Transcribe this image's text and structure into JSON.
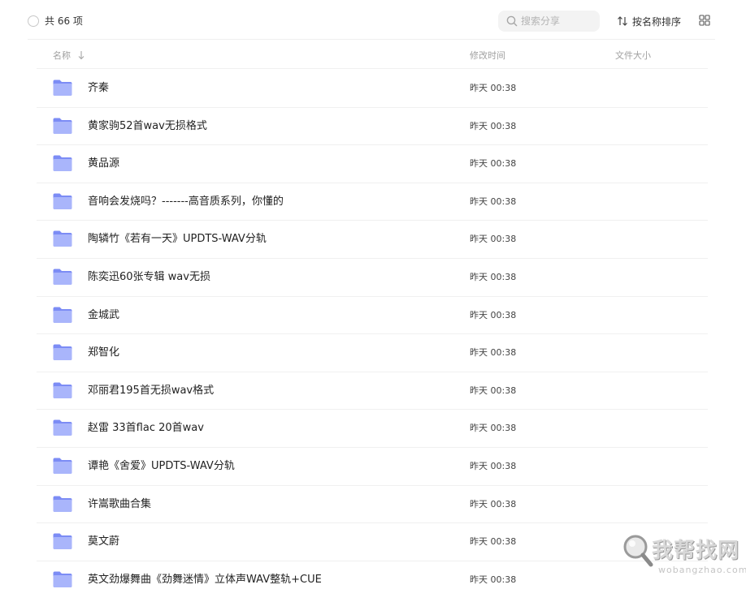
{
  "toolbar": {
    "count_label": "共 66 项",
    "search_placeholder": "搜索分享",
    "sort_label": "按名称排序"
  },
  "header": {
    "name": "名称",
    "modified": "修改时间",
    "size": "文件大小"
  },
  "files": [
    {
      "name": "齐秦",
      "modified": "昨天 00:38",
      "size": ""
    },
    {
      "name": "黄家驹52首wav无损格式",
      "modified": "昨天 00:38",
      "size": ""
    },
    {
      "name": "黄品源",
      "modified": "昨天 00:38",
      "size": ""
    },
    {
      "name": "音响会发烧吗？-------高音质系列，你懂的",
      "modified": "昨天 00:38",
      "size": ""
    },
    {
      "name": "陶辚竹《若有一天》UPDTS-WAV分轨",
      "modified": "昨天 00:38",
      "size": ""
    },
    {
      "name": "陈奕迅60张专辑 wav无损",
      "modified": "昨天 00:38",
      "size": ""
    },
    {
      "name": "金城武",
      "modified": "昨天 00:38",
      "size": ""
    },
    {
      "name": "郑智化",
      "modified": "昨天 00:38",
      "size": ""
    },
    {
      "name": "邓丽君195首无损wav格式",
      "modified": "昨天 00:38",
      "size": ""
    },
    {
      "name": "赵雷 33首flac 20首wav",
      "modified": "昨天 00:38",
      "size": ""
    },
    {
      "name": "谭艳《舍爱》UPDTS-WAV分轨",
      "modified": "昨天 00:38",
      "size": ""
    },
    {
      "name": "许嵩歌曲合集",
      "modified": "昨天 00:38",
      "size": ""
    },
    {
      "name": "莫文蔚",
      "modified": "昨天 00:38",
      "size": ""
    },
    {
      "name": "英文劲爆舞曲《劲舞迷情》立体声WAV整轨+CUE",
      "modified": "昨天 00:38",
      "size": ""
    }
  ],
  "watermark": {
    "cn": "我帮找网",
    "en": "wobangzhao.com"
  },
  "colors": {
    "folder": "#7c8cf5",
    "folder_light": "#a9b5fb",
    "divider": "#f0f0f0",
    "muted_text": "#a0a0a0"
  },
  "icons": {
    "search": "search-icon",
    "sort": "sort-icon",
    "grid": "grid-view-icon",
    "folder": "folder-icon",
    "sort_arrow": "arrow-down-icon"
  }
}
